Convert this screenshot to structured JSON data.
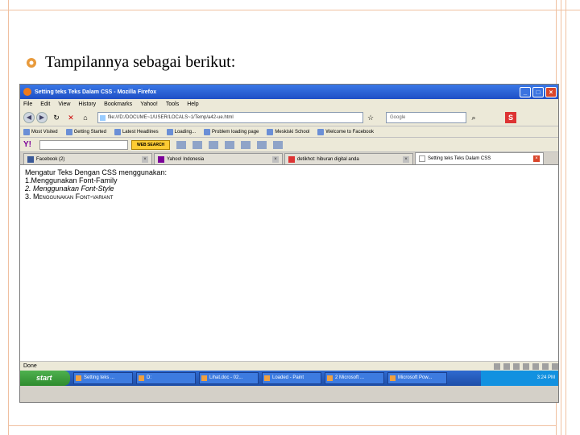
{
  "slide": {
    "bullet_text": "Tampilannya sebagai berikut:"
  },
  "browser": {
    "title": "Setting teks Teks Dalam CSS - Mozilla Firefox",
    "menu": [
      "File",
      "Edit",
      "View",
      "History",
      "Bookmarks",
      "Yahoo!",
      "Tools",
      "Help"
    ],
    "url": "file:///D:/DOCUME~1/USER/LOCALS~1/Temp/a42-ue.html",
    "search_placeholder": "Google",
    "bookmarks": [
      "Most Visited",
      "Getting Started",
      "Latest Headlines",
      "Loading...",
      "Problem loading page",
      "Meskiski School",
      "Welcome to Facebook"
    ],
    "yahoo_logo": "Y!",
    "web_search_label": "WEB SEARCH",
    "tabs": [
      {
        "label": "Facebook (2)"
      },
      {
        "label": "Yahoo! Indonesia"
      },
      {
        "label": "detikhot: hiburan digital anda"
      },
      {
        "label": "Setting teks Teks Dalam CSS"
      }
    ],
    "content_lines": [
      "Mengatur Teks Dengan CSS menggunakan:",
      "1.Menggunakan Font-Family",
      "2. Menggunakan Font-Style",
      "3. Menggunakan Font-variant"
    ],
    "status": "Done"
  },
  "taskbar": {
    "start": "start",
    "tasks": [
      "Setting teks ...",
      "D:",
      "Lihat.doc - 02...",
      "Loaded - Paint",
      "2 Microsoft ...",
      "Microsoft Pow..."
    ],
    "clock": "3:24 PM"
  }
}
